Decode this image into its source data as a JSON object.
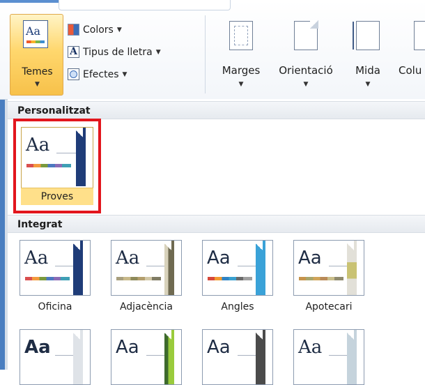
{
  "ribbon": {
    "themes_label": "Temes",
    "colors_label": "Colors",
    "fonts_label": "Tipus de lletra",
    "effects_label": "Efectes",
    "margins_label": "Marges",
    "orientation_label": "Orientació",
    "size_label": "Mida",
    "columns_label": "Colu",
    "caret": "▼"
  },
  "gallery": {
    "custom_header": "Personalitzat",
    "builtin_header": "Integrat",
    "custom_theme": "Proves",
    "themes": [
      "Oficina",
      "Adjacència",
      "Angles",
      "Apotecari"
    ],
    "thumb_text": "Aa"
  },
  "colors": {
    "accent_red": "#e2161d",
    "selected_bg": "#ffe08a"
  }
}
